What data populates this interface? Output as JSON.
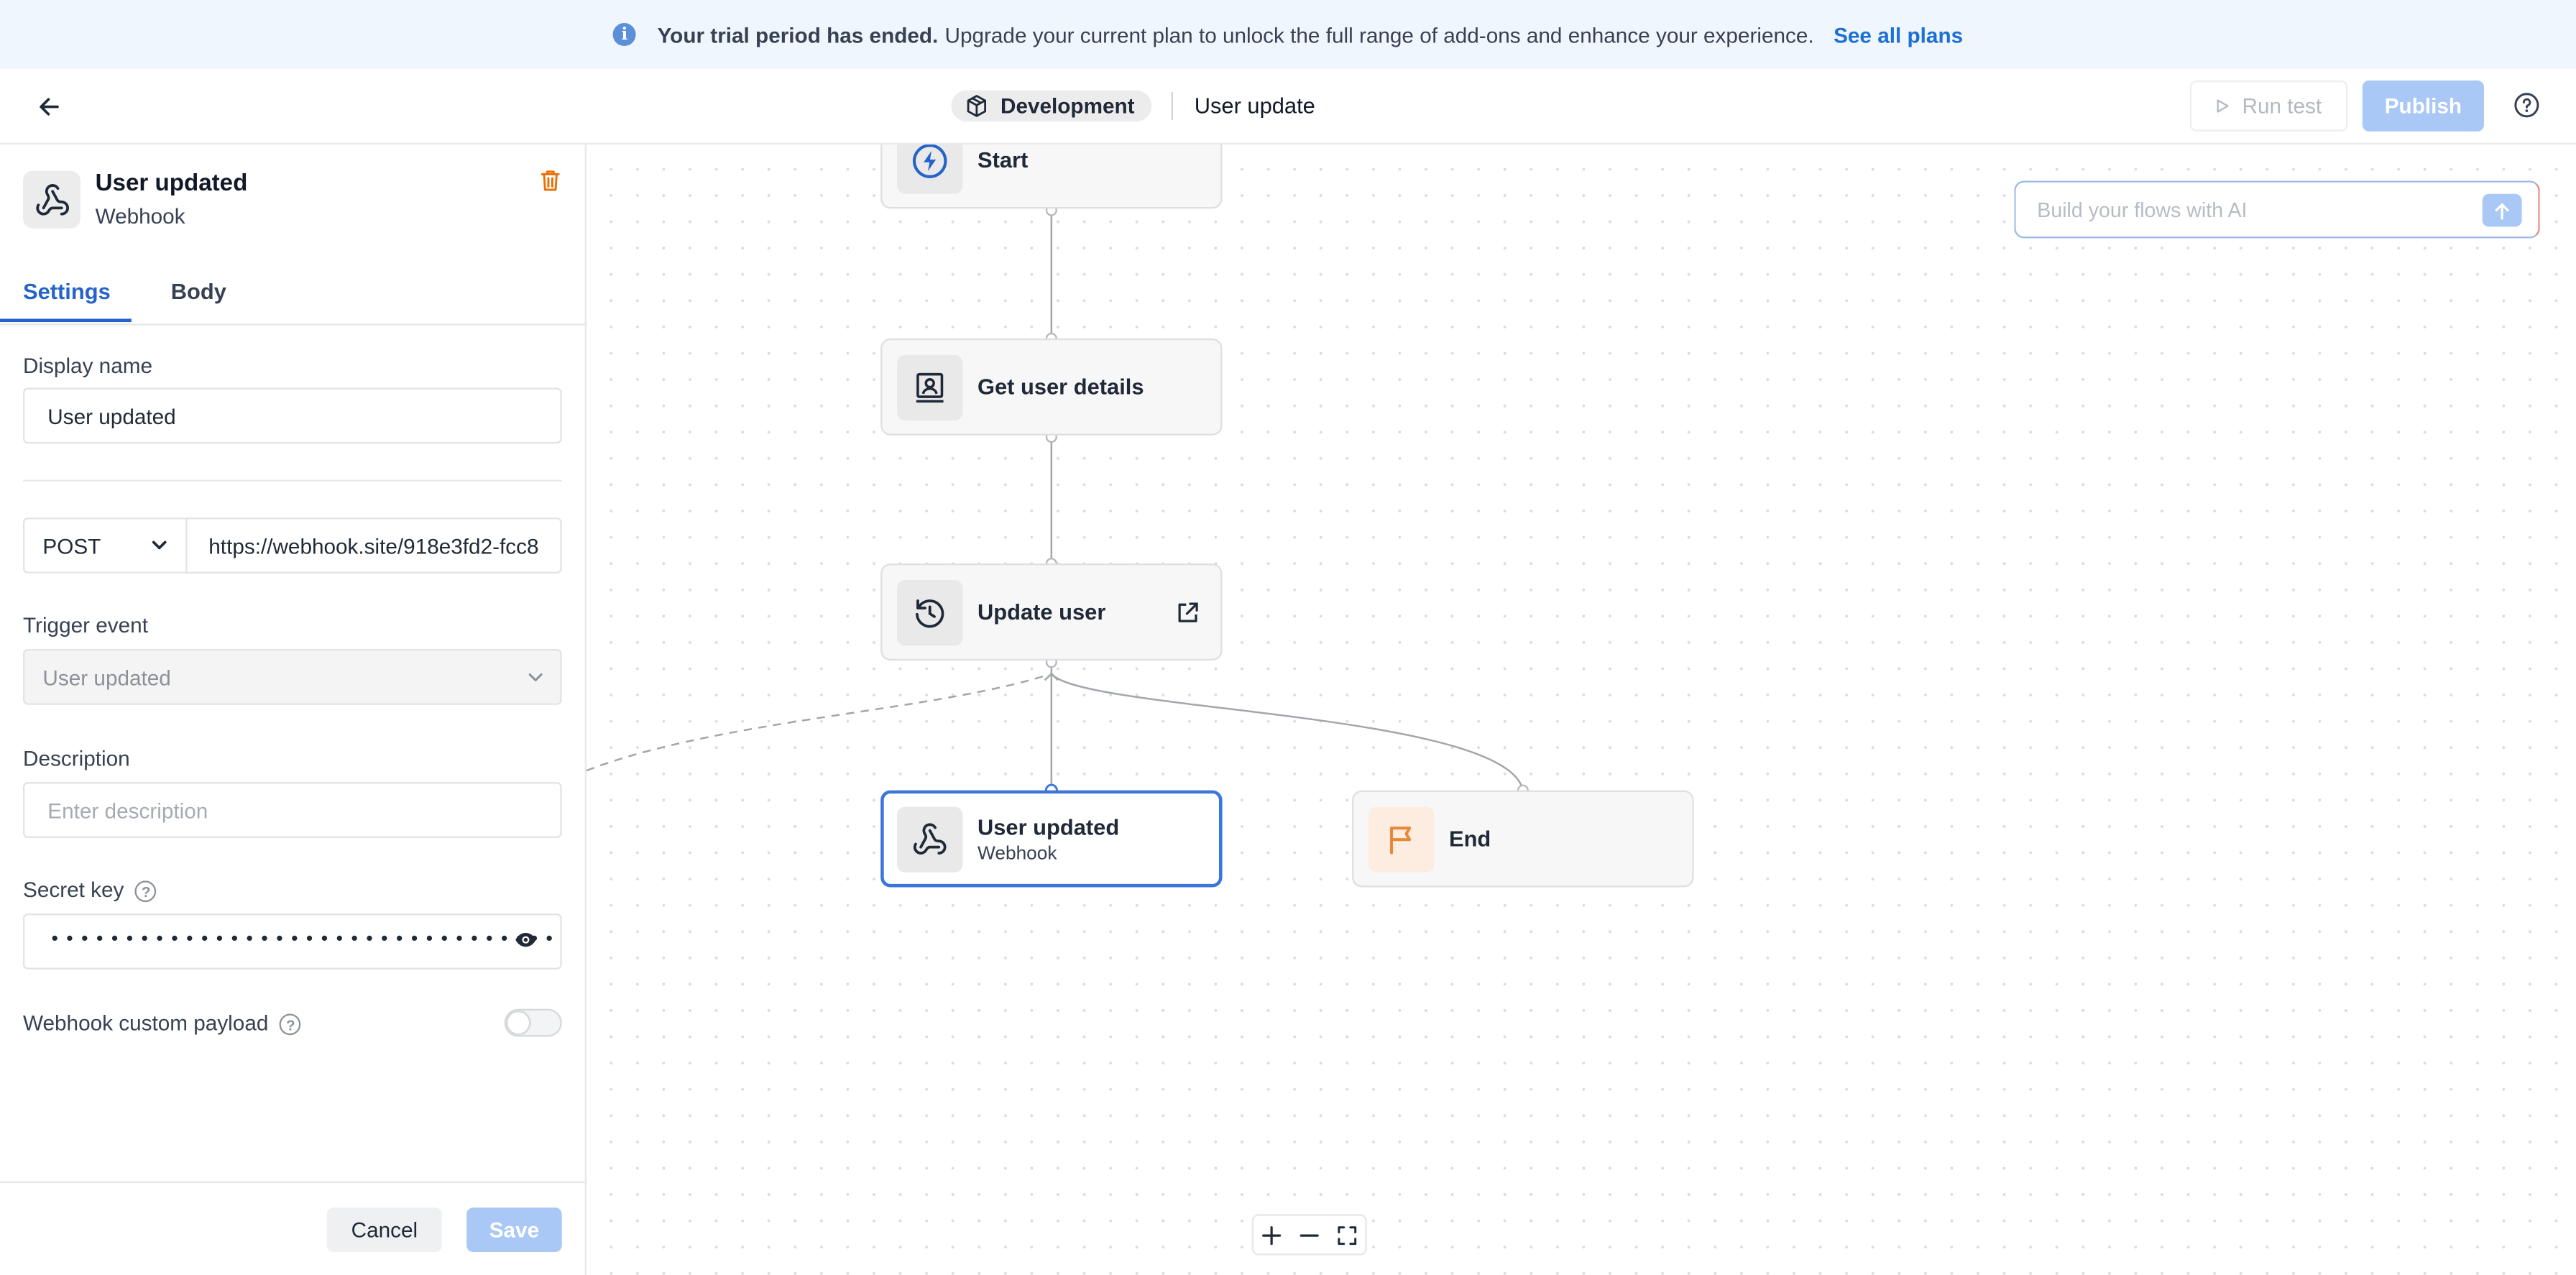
{
  "banner": {
    "strong_text": "Your trial period has ended.",
    "text": "Upgrade your current plan to unlock the full range of add-ons and enhance your experience.",
    "link": "See all plans"
  },
  "header": {
    "environment": "Development",
    "flow_name": "User update",
    "run_test_label": "Run test",
    "publish_label": "Publish"
  },
  "panel": {
    "node_title": "User updated",
    "node_subtitle": "Webhook",
    "tabs": [
      {
        "label": "Settings",
        "active": true
      },
      {
        "label": "Body",
        "active": false
      }
    ],
    "display_name_label": "Display name",
    "display_name_value": "User updated",
    "method": "POST",
    "url": "https://webhook.site/918e3fd2-fcc8",
    "trigger_event_label": "Trigger event",
    "trigger_event_value": "User updated",
    "description_label": "Description",
    "description_placeholder": "Enter description",
    "secret_key_label": "Secret key",
    "secret_key_masked": "••••••••••••••••••••••••••••••••••",
    "custom_payload_label": "Webhook custom payload",
    "custom_payload_enabled": false,
    "cancel_label": "Cancel",
    "save_label": "Save"
  },
  "canvas": {
    "ai_placeholder": "Build your flows with AI",
    "nodes": [
      {
        "id": "start",
        "title": "Start",
        "icon": "lightning-icon"
      },
      {
        "id": "get-user",
        "title": "Get user details",
        "icon": "contact-card-icon"
      },
      {
        "id": "update-user",
        "title": "Update user",
        "icon": "refresh-clock-icon"
      },
      {
        "id": "user-updated",
        "title": "User updated",
        "subtitle": "Webhook",
        "icon": "webhook-icon",
        "selected": true
      },
      {
        "id": "end",
        "title": "End",
        "icon": "flag-icon"
      }
    ]
  },
  "colors": {
    "accent": "#2563c9",
    "selected_border": "#3b76d8",
    "disabled_button": "#a9c8f6",
    "banner_bg": "#eff6fd",
    "danger": "#e8710a",
    "end_icon": "#e8893a"
  }
}
